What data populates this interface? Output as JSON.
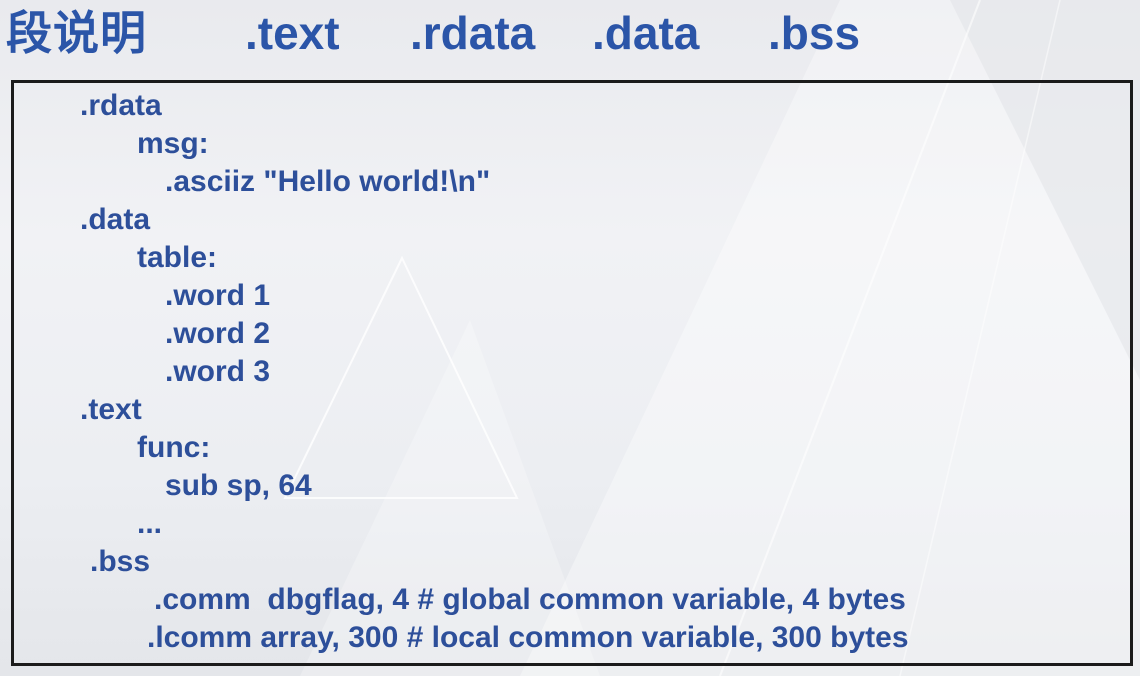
{
  "header": {
    "title": "段说明",
    "sections": [
      ".text",
      ".rdata",
      ".data",
      ".bss"
    ]
  },
  "code": {
    "lines": [
      ".rdata",
      "msg:",
      ".asciiz \"Hello world!\\n\"",
      ".data",
      "table:",
      ".word 1",
      ".word 2",
      ".word 3",
      ".text",
      "func:",
      "sub sp, 64",
      "...",
      ".bss",
      ".comm  dbgflag, 4 # global common variable, 4 bytes",
      ".lcomm array, 300 # local common variable, 300 bytes"
    ]
  },
  "colors": {
    "text": "#2d4f9a",
    "title": "#2b55a8",
    "border": "#1b1b1b"
  }
}
